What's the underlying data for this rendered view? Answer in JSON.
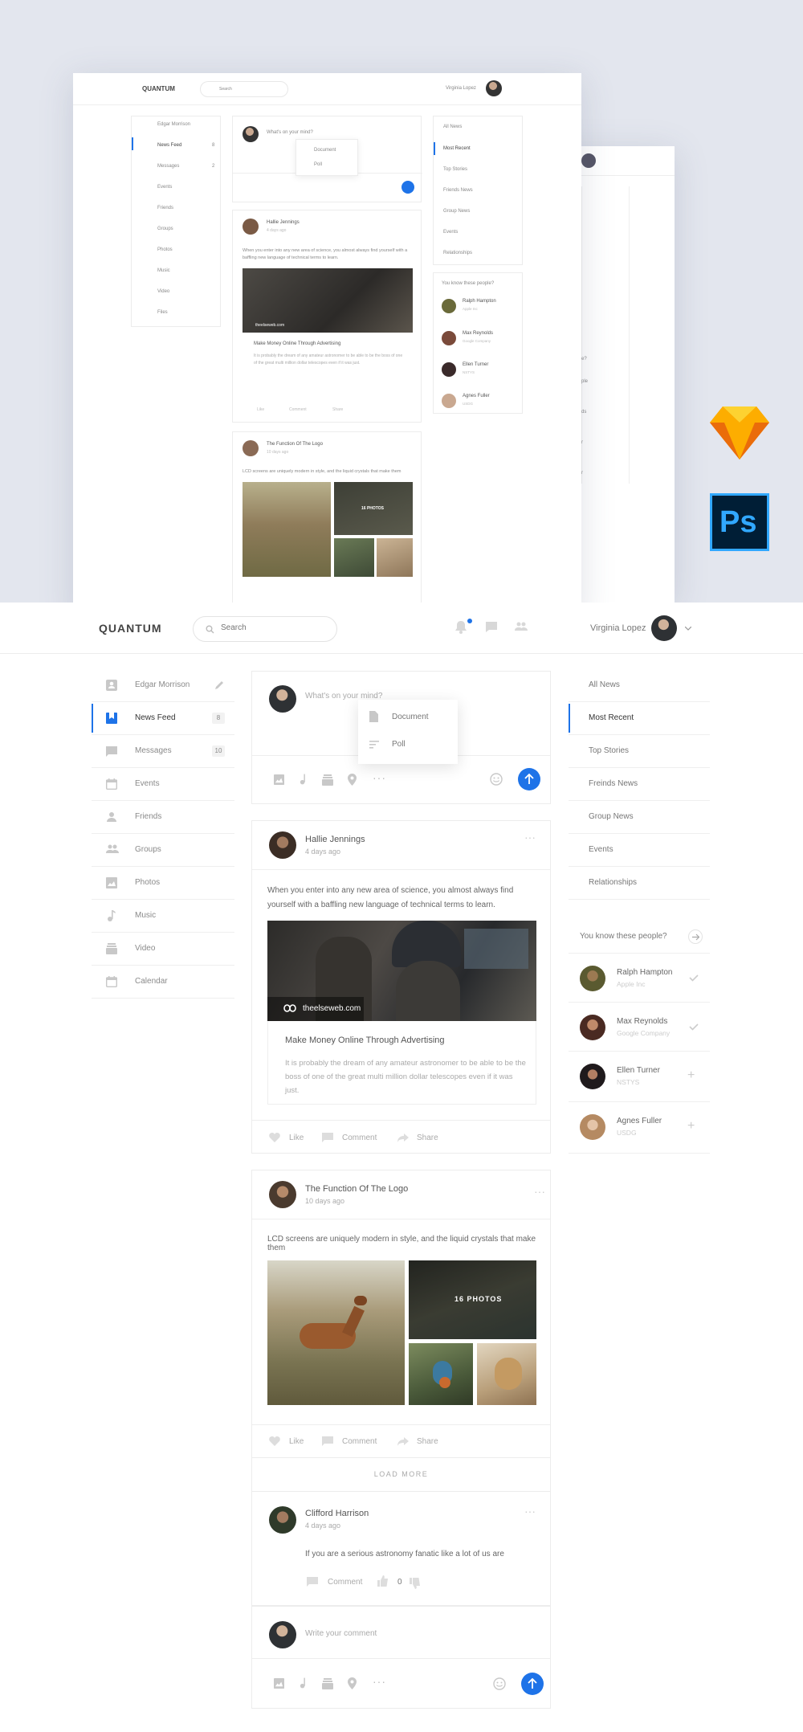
{
  "mockup": {
    "logo": "QUANTUM",
    "search_placeholder": "Search",
    "user_name": "Virginia Lopez",
    "composer_prompt": "What's on your mind?",
    "menu": [
      "Document",
      "Poll"
    ],
    "left_nav": [
      "Edgar Morrison",
      "News Feed",
      "Messages",
      "Events",
      "Friends",
      "Groups",
      "Photos",
      "Music",
      "Video",
      "Files"
    ],
    "left_badges": [
      "8",
      "2"
    ],
    "right_nav": [
      "All News",
      "Most Recent",
      "Top Stories",
      "Friends News",
      "Group News",
      "Events",
      "Relationships"
    ],
    "people_title": "You know these people?",
    "people": [
      {
        "name": "Ralph Hampton",
        "company": "Apple Inc"
      },
      {
        "name": "Max Reynolds",
        "company": "Google Company"
      },
      {
        "name": "Ellen Turner",
        "company": "NSTYS"
      },
      {
        "name": "Agnes Fuller",
        "company": "USDG"
      }
    ],
    "post1": {
      "author": "Hallie Jennings",
      "time": "4 days ago",
      "text": "When you enter into any new area of science, you almost always find yourself with a baffling new language of technical terms to learn.",
      "link_domain": "theelseweb.com",
      "link_title": "Make Money Online Through Advertising",
      "link_desc": "It is probably the dream of any amateur astronomer to be able to be the boss of one of the great multi million dollar telescopes even if it was just.",
      "actions": [
        "Like",
        "Comment",
        "Share"
      ]
    },
    "post2": {
      "author": "The Function Of The Logo",
      "time": "10 days ago",
      "text": "LCD screens are uniquely modern in style, and the liquid crystals that make them",
      "photo_count": "16 PHOTOS"
    },
    "back_window_fragments": [
      "e?",
      "ple",
      "ds",
      "r",
      "r"
    ]
  },
  "apps": {
    "sketch": "sketch-icon",
    "photoshop_label": "Ps"
  },
  "header": {
    "logo": "QUANTUM",
    "search_placeholder": "Search",
    "user_name": "Virginia Lopez"
  },
  "sidebar": {
    "items": [
      {
        "label": "Edgar Morrison",
        "icon": "user-icon"
      },
      {
        "label": "News Feed",
        "icon": "bookmark-icon",
        "badge": "8",
        "active": true
      },
      {
        "label": "Messages",
        "icon": "message-icon",
        "badge": "10"
      },
      {
        "label": "Events",
        "icon": "calendar-icon"
      },
      {
        "label": "Friends",
        "icon": "person-icon"
      },
      {
        "label": "Groups",
        "icon": "group-icon"
      },
      {
        "label": "Photos",
        "icon": "image-icon"
      },
      {
        "label": "Music",
        "icon": "music-icon"
      },
      {
        "label": "Video",
        "icon": "video-icon"
      },
      {
        "label": "Calendar",
        "icon": "calendar-icon"
      }
    ]
  },
  "composer": {
    "placeholder": "What's on your mind?",
    "menu": [
      "Document",
      "Poll"
    ]
  },
  "posts": [
    {
      "author": "Hallie Jennings",
      "time": "4 days ago",
      "text": "When you enter into any new area of science, you almost always find yourself with a baffling new language of technical terms to learn.",
      "link": {
        "domain": "theelseweb.com",
        "title": "Make Money Online Through Advertising",
        "description": "It is probably the dream of any amateur astronomer to be able to be the boss of one of the great multi million dollar telescopes even if it was just."
      },
      "actions": [
        "Like",
        "Comment",
        "Share"
      ]
    },
    {
      "author": "The Function Of The Logo",
      "time": "10 days ago",
      "text": "LCD screens are uniquely modern in style, and the liquid crystals that make them",
      "photo_count": "16 PHOTOS",
      "actions": [
        "Like",
        "Comment",
        "Share"
      ]
    }
  ],
  "load_more": "LOAD MORE",
  "comment": {
    "author": "Clifford Harrison",
    "time": "4 days ago",
    "text": "If you are a serious astronomy fanatic like a lot of us are",
    "action": "Comment",
    "likes": "0",
    "input_placeholder": "Write your comment"
  },
  "right_nav": {
    "items": [
      "All News",
      "Most Recent",
      "Top Stories",
      "Freinds News",
      "Group News",
      "Events",
      "Relationships"
    ],
    "active_index": 1
  },
  "people": {
    "title": "You know these people?",
    "list": [
      {
        "name": "Ralph Hampton",
        "company": "Apple Inc",
        "state": "added"
      },
      {
        "name": "Max Reynolds",
        "company": "Google Company",
        "state": "added"
      },
      {
        "name": "Ellen Turner",
        "company": "NSTYS",
        "state": "add"
      },
      {
        "name": "Agnes Fuller",
        "company": "USDG",
        "state": "add"
      }
    ]
  },
  "colors": {
    "accent": "#1e73e8",
    "hero_bg": "#e3e6ee",
    "sketch": "#f7a41d",
    "photoshop": "#31a8ff"
  }
}
